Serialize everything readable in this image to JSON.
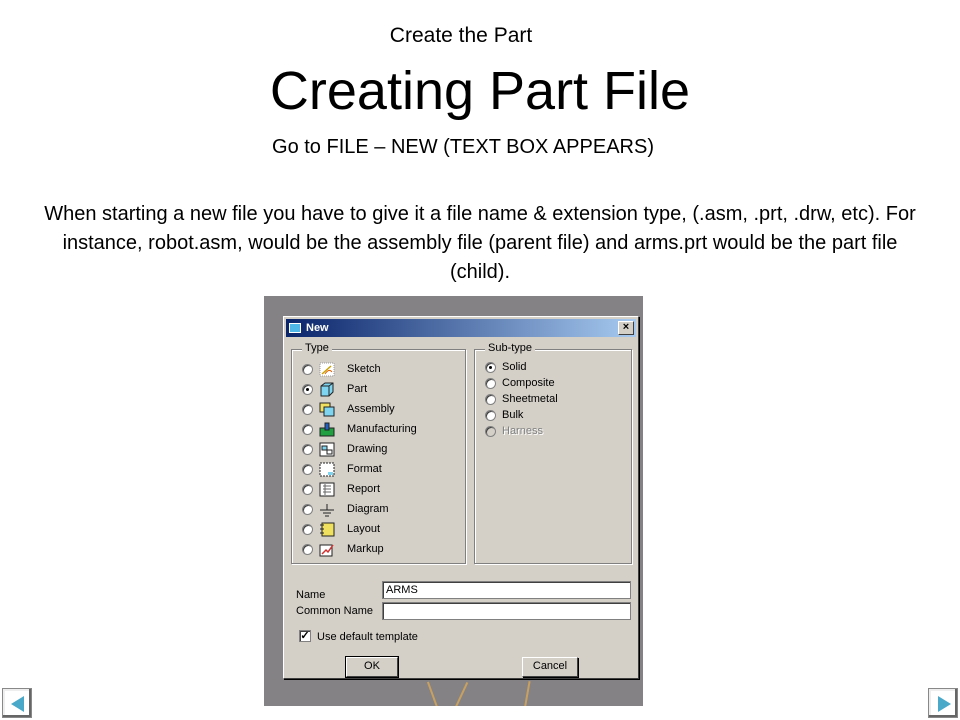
{
  "slide": {
    "subtitle": "Create the Part",
    "title": "Creating Part File",
    "instruction": "Go to FILE – NEW (TEXT BOX APPEARS)",
    "body": "When starting a new file you have to give it a file name & extension type, (.asm, .prt, .drw, etc).  For instance, robot.asm, would be the assembly file (parent file) and arms.prt would be the part file (child)."
  },
  "dialog": {
    "title": "New",
    "close_label": "×",
    "type_group": {
      "label": "Type",
      "items": [
        {
          "label": "Sketch",
          "icon": "sketch-icon",
          "selected": false
        },
        {
          "label": "Part",
          "icon": "part-icon",
          "selected": true
        },
        {
          "label": "Assembly",
          "icon": "assembly-icon",
          "selected": false
        },
        {
          "label": "Manufacturing",
          "icon": "manufacturing-icon",
          "selected": false
        },
        {
          "label": "Drawing",
          "icon": "drawing-icon",
          "selected": false
        },
        {
          "label": "Format",
          "icon": "format-icon",
          "selected": false
        },
        {
          "label": "Report",
          "icon": "report-icon",
          "selected": false
        },
        {
          "label": "Diagram",
          "icon": "diagram-icon",
          "selected": false
        },
        {
          "label": "Layout",
          "icon": "layout-icon",
          "selected": false
        },
        {
          "label": "Markup",
          "icon": "markup-icon",
          "selected": false
        }
      ]
    },
    "subtype_group": {
      "label": "Sub-type",
      "items": [
        {
          "label": "Solid",
          "selected": true,
          "disabled": false
        },
        {
          "label": "Composite",
          "selected": false,
          "disabled": false
        },
        {
          "label": "Sheetmetal",
          "selected": false,
          "disabled": false
        },
        {
          "label": "Bulk",
          "selected": false,
          "disabled": false
        },
        {
          "label": "Harness",
          "selected": false,
          "disabled": true
        }
      ]
    },
    "name_label": "Name",
    "name_value": "ARMS",
    "common_name_label": "Common Name",
    "common_name_value": "",
    "default_template_label": "Use default template",
    "default_template_checked": true,
    "ok_label": "OK",
    "cancel_label": "Cancel"
  },
  "nav": {
    "prev_icon": "arrow-left-icon",
    "next_icon": "arrow-right-icon"
  },
  "colors": {
    "titlebar_start": "#0a246a",
    "titlebar_end": "#a6caf0",
    "dialog_bg": "#d4d0c8",
    "nav_arrow": "#4aa9c9"
  }
}
